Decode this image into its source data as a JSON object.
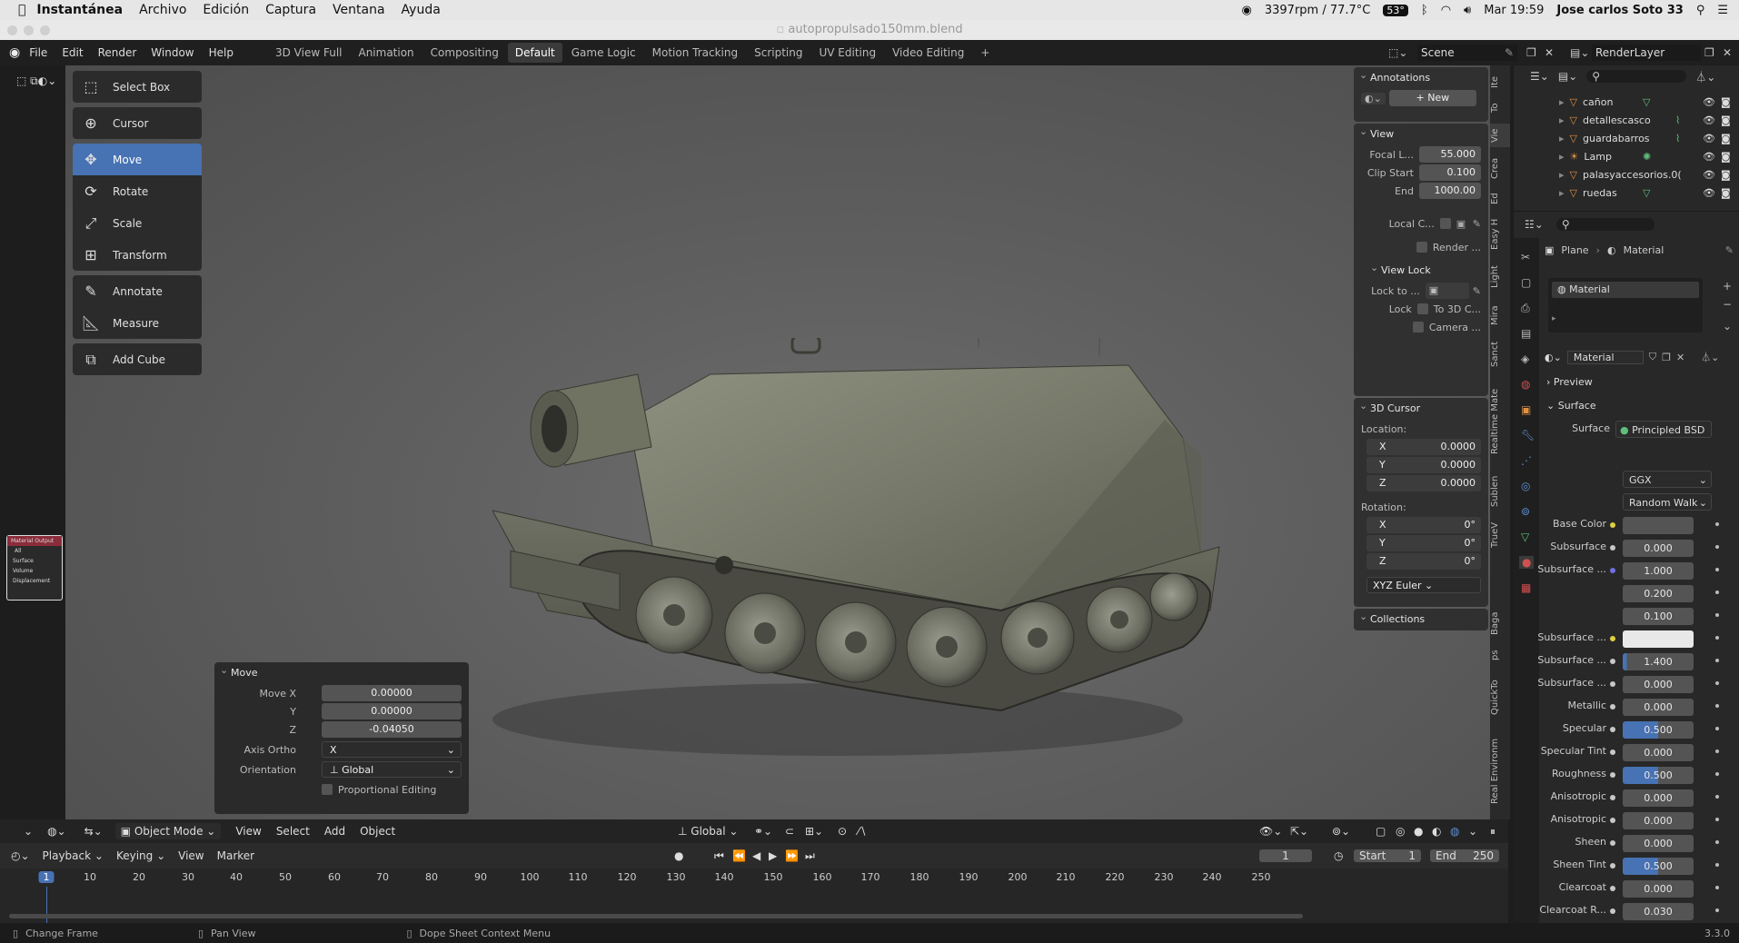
{
  "mac_menubar": {
    "app": "Instantánea",
    "menus": [
      "Archivo",
      "Edición",
      "Captura",
      "Ventana",
      "Ayuda"
    ],
    "status": "3397rpm / 77.7°C",
    "temp_badge": "53°",
    "clock": "Mar 19:59",
    "user": "Jose carlos Soto 33"
  },
  "window_title": "autopropulsado150mm.blend",
  "blender_menu": [
    "File",
    "Edit",
    "Render",
    "Window",
    "Help"
  ],
  "workspaces": [
    "3D View Full",
    "Animation",
    "Compositing",
    "Default",
    "Game Logic",
    "Motion Tracking",
    "Scripting",
    "UV Editing",
    "Video Editing",
    "+"
  ],
  "active_workspace": "Default",
  "scene": {
    "name": "Scene",
    "render_layer": "RenderLayer"
  },
  "tools": {
    "select_box": "Select Box",
    "cursor": "Cursor",
    "move": "Move",
    "rotate": "Rotate",
    "scale": "Scale",
    "transform": "Transform",
    "annotate": "Annotate",
    "measure": "Measure",
    "add_cube": "Add Cube"
  },
  "npanel": {
    "annotations_title": "Annotations",
    "new_label": "New",
    "view_title": "View",
    "focal_label": "Focal L...",
    "focal_value": "55.000",
    "clip_start_label": "Clip Start",
    "clip_start_value": "0.100",
    "end_label": "End",
    "end_value": "1000.00",
    "local_c_label": "Local C...",
    "render_label": "Render ...",
    "view_lock_title": "View Lock",
    "lock_to_label": "Lock to ...",
    "lock_label": "Lock",
    "to_3d_label": "To 3D C...",
    "camera_label": "Camera ...",
    "cursor_title": "3D Cursor",
    "location_label": "Location:",
    "loc_x": "0.0000",
    "loc_y": "0.0000",
    "loc_z": "0.0000",
    "rotation_label": "Rotation:",
    "rot_x": "0°",
    "rot_y": "0°",
    "rot_z": "0°",
    "x": "X",
    "y": "Y",
    "z": "Z",
    "rot_mode": "XYZ Euler",
    "collections_title": "Collections"
  },
  "vtabs": [
    "Ite",
    "To",
    "Vie",
    "Crea",
    "Ed",
    "Easy H",
    "Light",
    "Mira",
    "Sanct",
    "Realtime Mate",
    "Sublen",
    "TrueV",
    "Baga",
    "ps",
    "QuickTo",
    "Real Environm"
  ],
  "outliner": {
    "items": [
      {
        "name": "cañon"
      },
      {
        "name": "detallescasco"
      },
      {
        "name": "guardabarros"
      },
      {
        "name": "Lamp"
      },
      {
        "name": "palasyaccesorios.0("
      },
      {
        "name": "ruedas"
      }
    ]
  },
  "properties": {
    "breadcrumb_object": "Plane",
    "breadcrumb_material": "Material",
    "slot": "Material",
    "material_name": "Material",
    "preview_label": "Preview",
    "surface_section": "Surface",
    "surface_label": "Surface",
    "shader": "Principled BSD",
    "distribution": "GGX",
    "subsurface_method": "Random Walk",
    "rows": [
      {
        "label": "Base Color",
        "value": "",
        "dot": "#e0d040",
        "kind": "color"
      },
      {
        "label": "Subsurface",
        "value": "0.000",
        "dot": "#c8c8c8",
        "kind": "num"
      },
      {
        "label": "Subsurface ...",
        "value": "1.000",
        "dot": "#7070e0",
        "kind": "num"
      },
      {
        "label": "",
        "value": "0.200",
        "dot": "",
        "kind": "num"
      },
      {
        "label": "",
        "value": "0.100",
        "dot": "",
        "kind": "num"
      },
      {
        "label": "Subsurface ...",
        "value": "",
        "dot": "#e0d040",
        "kind": "white"
      },
      {
        "label": "Subsurface ...",
        "value": "1.400",
        "dot": "#c8c8c8",
        "kind": "num"
      },
      {
        "label": "Subsurface ...",
        "value": "0.000",
        "dot": "#c8c8c8",
        "kind": "num"
      },
      {
        "label": "Metallic",
        "value": "0.000",
        "dot": "#c8c8c8",
        "kind": "num"
      },
      {
        "label": "Specular",
        "value": "0.500",
        "dot": "#c8c8c8",
        "kind": "blue"
      },
      {
        "label": "Specular Tint",
        "value": "0.000",
        "dot": "#c8c8c8",
        "kind": "num"
      },
      {
        "label": "Roughness",
        "value": "0.500",
        "dot": "#c8c8c8",
        "kind": "blue"
      },
      {
        "label": "Anisotropic",
        "value": "0.000",
        "dot": "#c8c8c8",
        "kind": "num"
      },
      {
        "label": "Anisotropic",
        "value": "0.000",
        "dot": "#c8c8c8",
        "kind": "num"
      },
      {
        "label": "Sheen",
        "value": "0.000",
        "dot": "#c8c8c8",
        "kind": "num"
      },
      {
        "label": "Sheen Tint",
        "value": "0.500",
        "dot": "#c8c8c8",
        "kind": "blue"
      },
      {
        "label": "Clearcoat",
        "value": "0.000",
        "dot": "#c8c8c8",
        "kind": "num"
      },
      {
        "label": "Clearcoat R...",
        "value": "0.030",
        "dot": "#c8c8c8",
        "kind": "num"
      }
    ]
  },
  "move_panel": {
    "title": "Move",
    "move_x_label": "Move X",
    "move_x": "0.00000",
    "y_label": "Y",
    "move_y": "0.00000",
    "z_label": "Z",
    "move_z": "-0.04050",
    "axis_ortho_label": "Axis Ortho",
    "axis_ortho": "X",
    "orientation_label": "Orientation",
    "orientation": "Global",
    "proportional": "Proportional Editing"
  },
  "viewport_header": {
    "mode": "Object Mode",
    "menus": [
      "View",
      "Select",
      "Add",
      "Object"
    ],
    "transform_orientation": "Global"
  },
  "timeline": {
    "menus": [
      "Playback",
      "Keying",
      "View",
      "Marker"
    ],
    "current_frame": "1",
    "start_label": "Start",
    "start": "1",
    "end_label": "End",
    "end": "250",
    "ruler": [
      "1",
      "10",
      "20",
      "30",
      "40",
      "50",
      "60",
      "70",
      "80",
      "90",
      "100",
      "110",
      "120",
      "130",
      "140",
      "150",
      "160",
      "170",
      "180",
      "190",
      "200",
      "210",
      "220",
      "230",
      "240",
      "250"
    ]
  },
  "statusbar": {
    "left": "Change Frame",
    "mid": "Pan View",
    "right": "Dope Sheet Context Menu",
    "version": "3.3.0"
  },
  "node_minimap": {
    "title": "Material Output",
    "items": [
      "All",
      "Surface",
      "Volume",
      "Displacement"
    ]
  }
}
